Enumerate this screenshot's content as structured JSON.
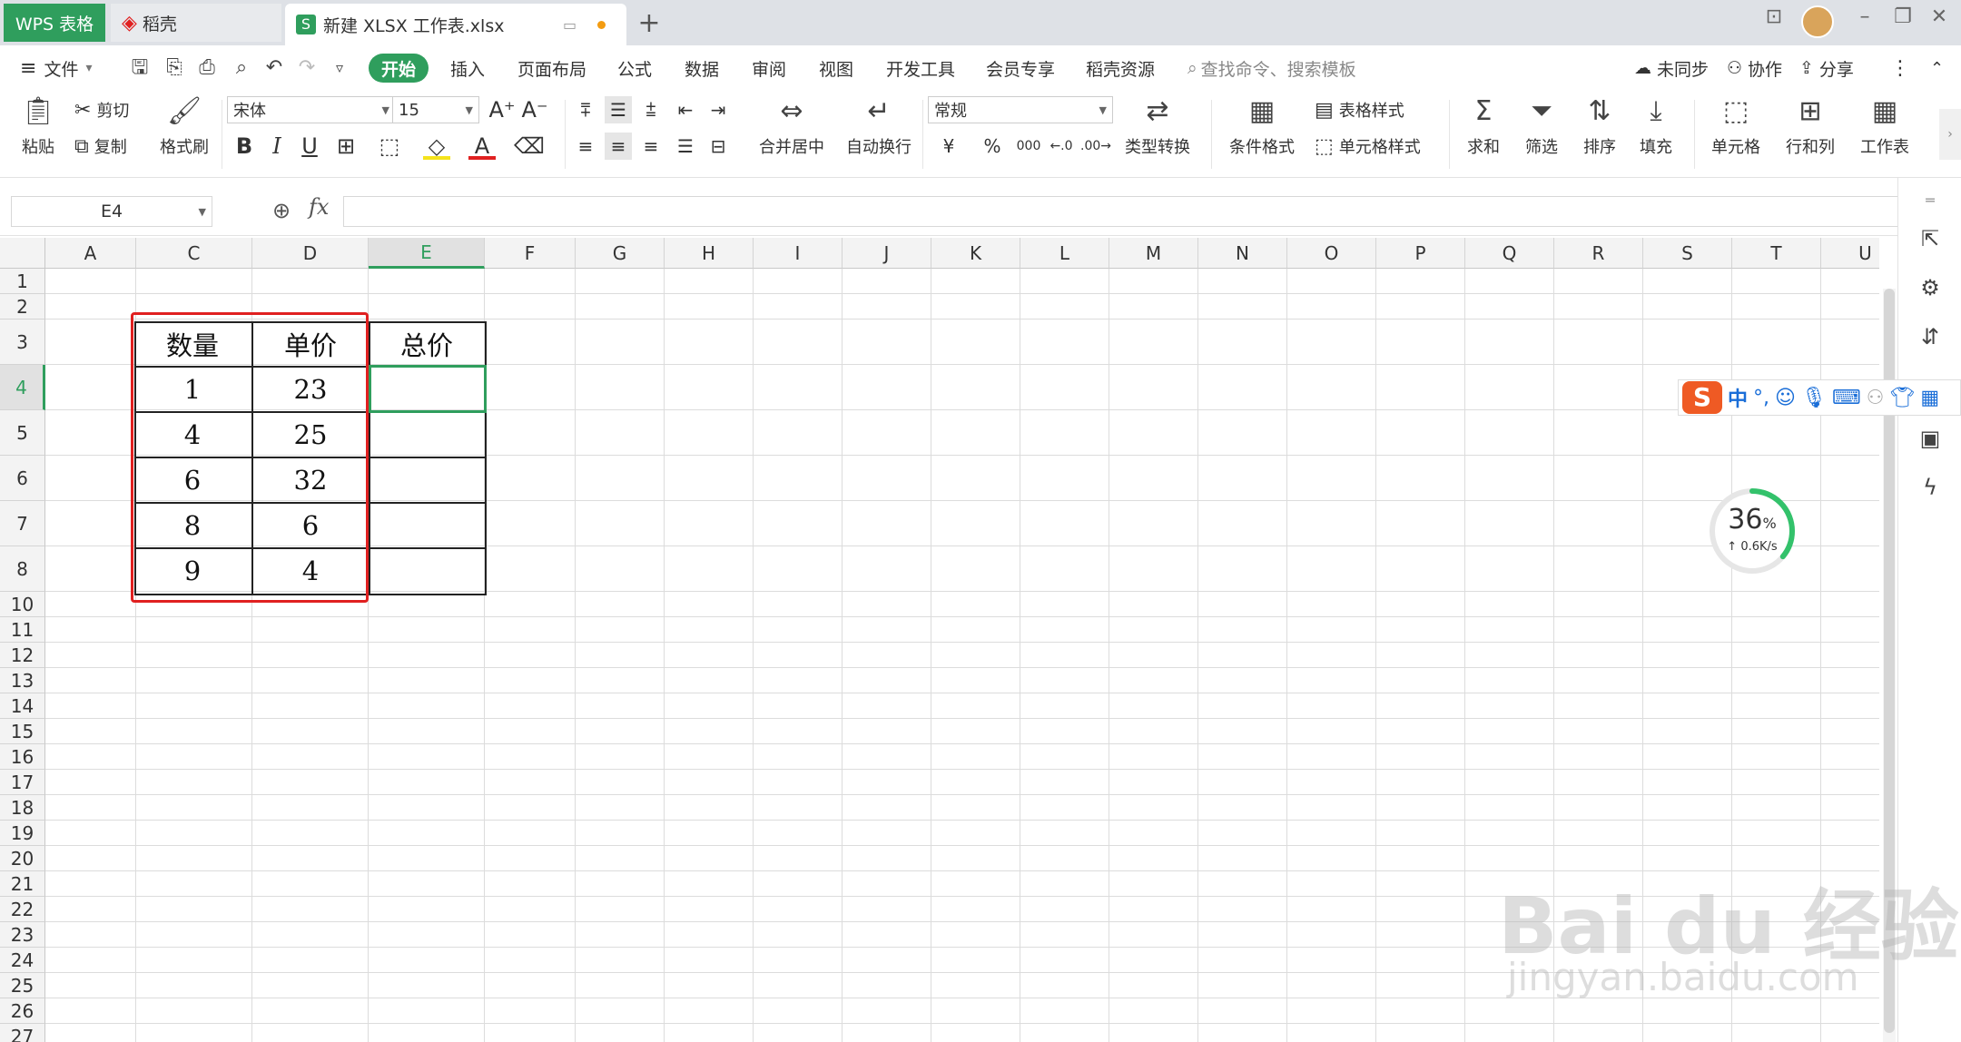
{
  "titlebar": {
    "wps_tab": "WPS 表格",
    "daoke_tab": "稻壳",
    "doc_tab": "新建 XLSX 工作表.xlsx",
    "add_tab": "+"
  },
  "menubar": {
    "file": "文件",
    "start": "开始",
    "items": [
      "插入",
      "页面布局",
      "公式",
      "数据",
      "审阅",
      "视图",
      "开发工具",
      "会员专享",
      "稻壳资源"
    ],
    "search_placeholder": "查找命令、搜索模板",
    "unsync": "未同步",
    "collab": "协作",
    "share": "分享"
  },
  "ribbon": {
    "paste": "粘贴",
    "cut": "剪切",
    "copy": "复制",
    "format_painter": "格式刷",
    "font_name": "宋体",
    "font_size": "15",
    "merge_center": "合并居中",
    "auto_wrap": "自动换行",
    "number_format": "常规",
    "type_convert": "类型转换",
    "cond_format": "条件格式",
    "table_style": "表格样式",
    "cell_style": "单元格样式",
    "sum": "求和",
    "filter": "筛选",
    "sort": "排序",
    "fill": "填充",
    "cell": "单元格",
    "row_col": "行和列",
    "worksheet": "工作表",
    "bold": "B",
    "italic": "I",
    "underline": "U",
    "currency": "¥",
    "percent": "%",
    "thousands": "000"
  },
  "formula_bar": {
    "name_box": "E4",
    "fx": "fx",
    "content": ""
  },
  "sheet": {
    "columns": [
      "A",
      "C",
      "D",
      "E",
      "F",
      "G",
      "H",
      "I",
      "J",
      "K",
      "L",
      "M",
      "N",
      "O",
      "P",
      "Q",
      "R",
      "S",
      "T",
      "U"
    ],
    "active_column": "E",
    "rows": [
      "1",
      "2",
      "3",
      "4",
      "5",
      "6",
      "7",
      "8",
      "10",
      "11",
      "12",
      "13",
      "14",
      "15",
      "16",
      "17",
      "18",
      "19",
      "20",
      "21",
      "22",
      "23",
      "24",
      "25",
      "26",
      "27"
    ],
    "active_row": "4",
    "table": {
      "headers": [
        "数量",
        "单价",
        "总价"
      ],
      "rows": [
        [
          "1",
          "23",
          ""
        ],
        [
          "4",
          "25",
          ""
        ],
        [
          "6",
          "32",
          ""
        ],
        [
          "8",
          "6",
          ""
        ],
        [
          "9",
          "4",
          ""
        ]
      ]
    }
  },
  "ime": {
    "logo": "S",
    "lang": "中",
    "punct": "°,"
  },
  "network_gauge": {
    "percent": "36",
    "percent_sign": "%",
    "speed": "↑ 0.6K/s",
    "level": 0.36
  },
  "watermark": {
    "brand": "Bai du 经验",
    "url": "jingyan.baidu.com"
  },
  "colors": {
    "accent": "#2f9e5d",
    "highlight": "#e02020"
  }
}
